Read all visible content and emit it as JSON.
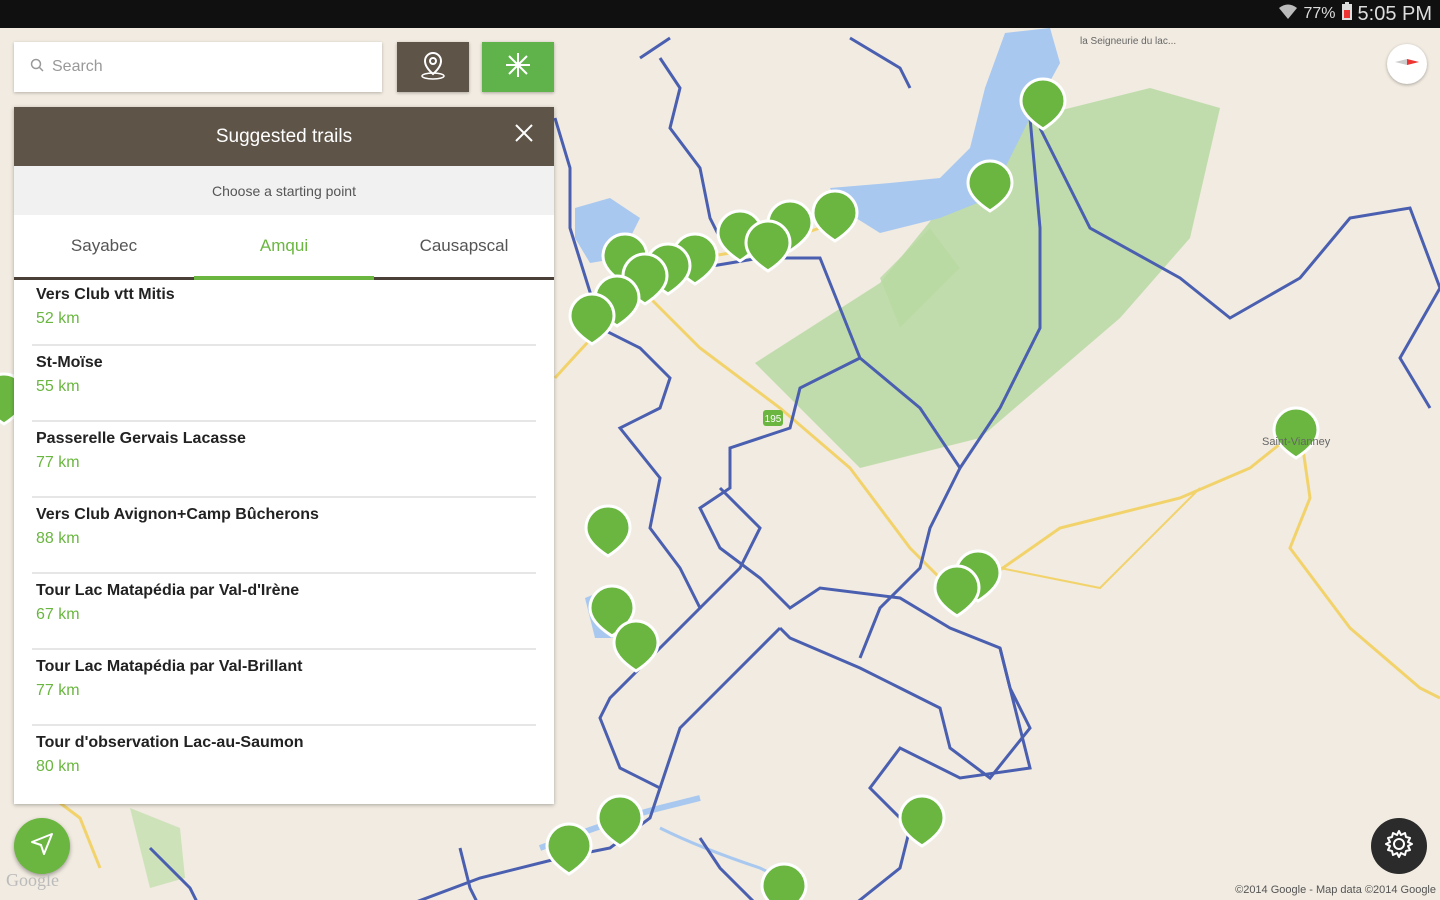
{
  "status_bar": {
    "battery": "77%",
    "time": "5:05 PM"
  },
  "search": {
    "placeholder": "Search"
  },
  "panel": {
    "title": "Suggested trails",
    "subtitle": "Choose a starting point",
    "tabs": [
      {
        "label": "Sayabec"
      },
      {
        "label": "Amqui"
      },
      {
        "label": "Causapscal"
      }
    ],
    "active_tab": "Amqui",
    "trails": [
      {
        "name": "Vers Club vtt Mitis",
        "distance": "52 km"
      },
      {
        "name": "St-Moïse",
        "distance": "55 km"
      },
      {
        "name": "Passerelle Gervais Lacasse",
        "distance": "77 km"
      },
      {
        "name": "Vers Club Avignon+Camp Bûcherons",
        "distance": "88 km"
      },
      {
        "name": "Tour Lac Matapédia par Val-d'Irène",
        "distance": "67 km"
      },
      {
        "name": "Tour Lac Matapédia par Val-Brillant",
        "distance": "77 km"
      },
      {
        "name": "Tour d'observation Lac-au-Saumon",
        "distance": "80 km"
      }
    ]
  },
  "map": {
    "labels": {
      "saint_vianney": "Saint-Vianney",
      "seigneurie": "la Seigneurie du lac...",
      "route": "195"
    },
    "google_logo": "Google",
    "copyright": "©2014 Google - Map data ©2014 Google"
  },
  "colors": {
    "accent_green": "#6ab640",
    "header_brown": "#5e5448",
    "trail_blue": "#4a5fb0",
    "park_green": "#b8d9a2"
  }
}
